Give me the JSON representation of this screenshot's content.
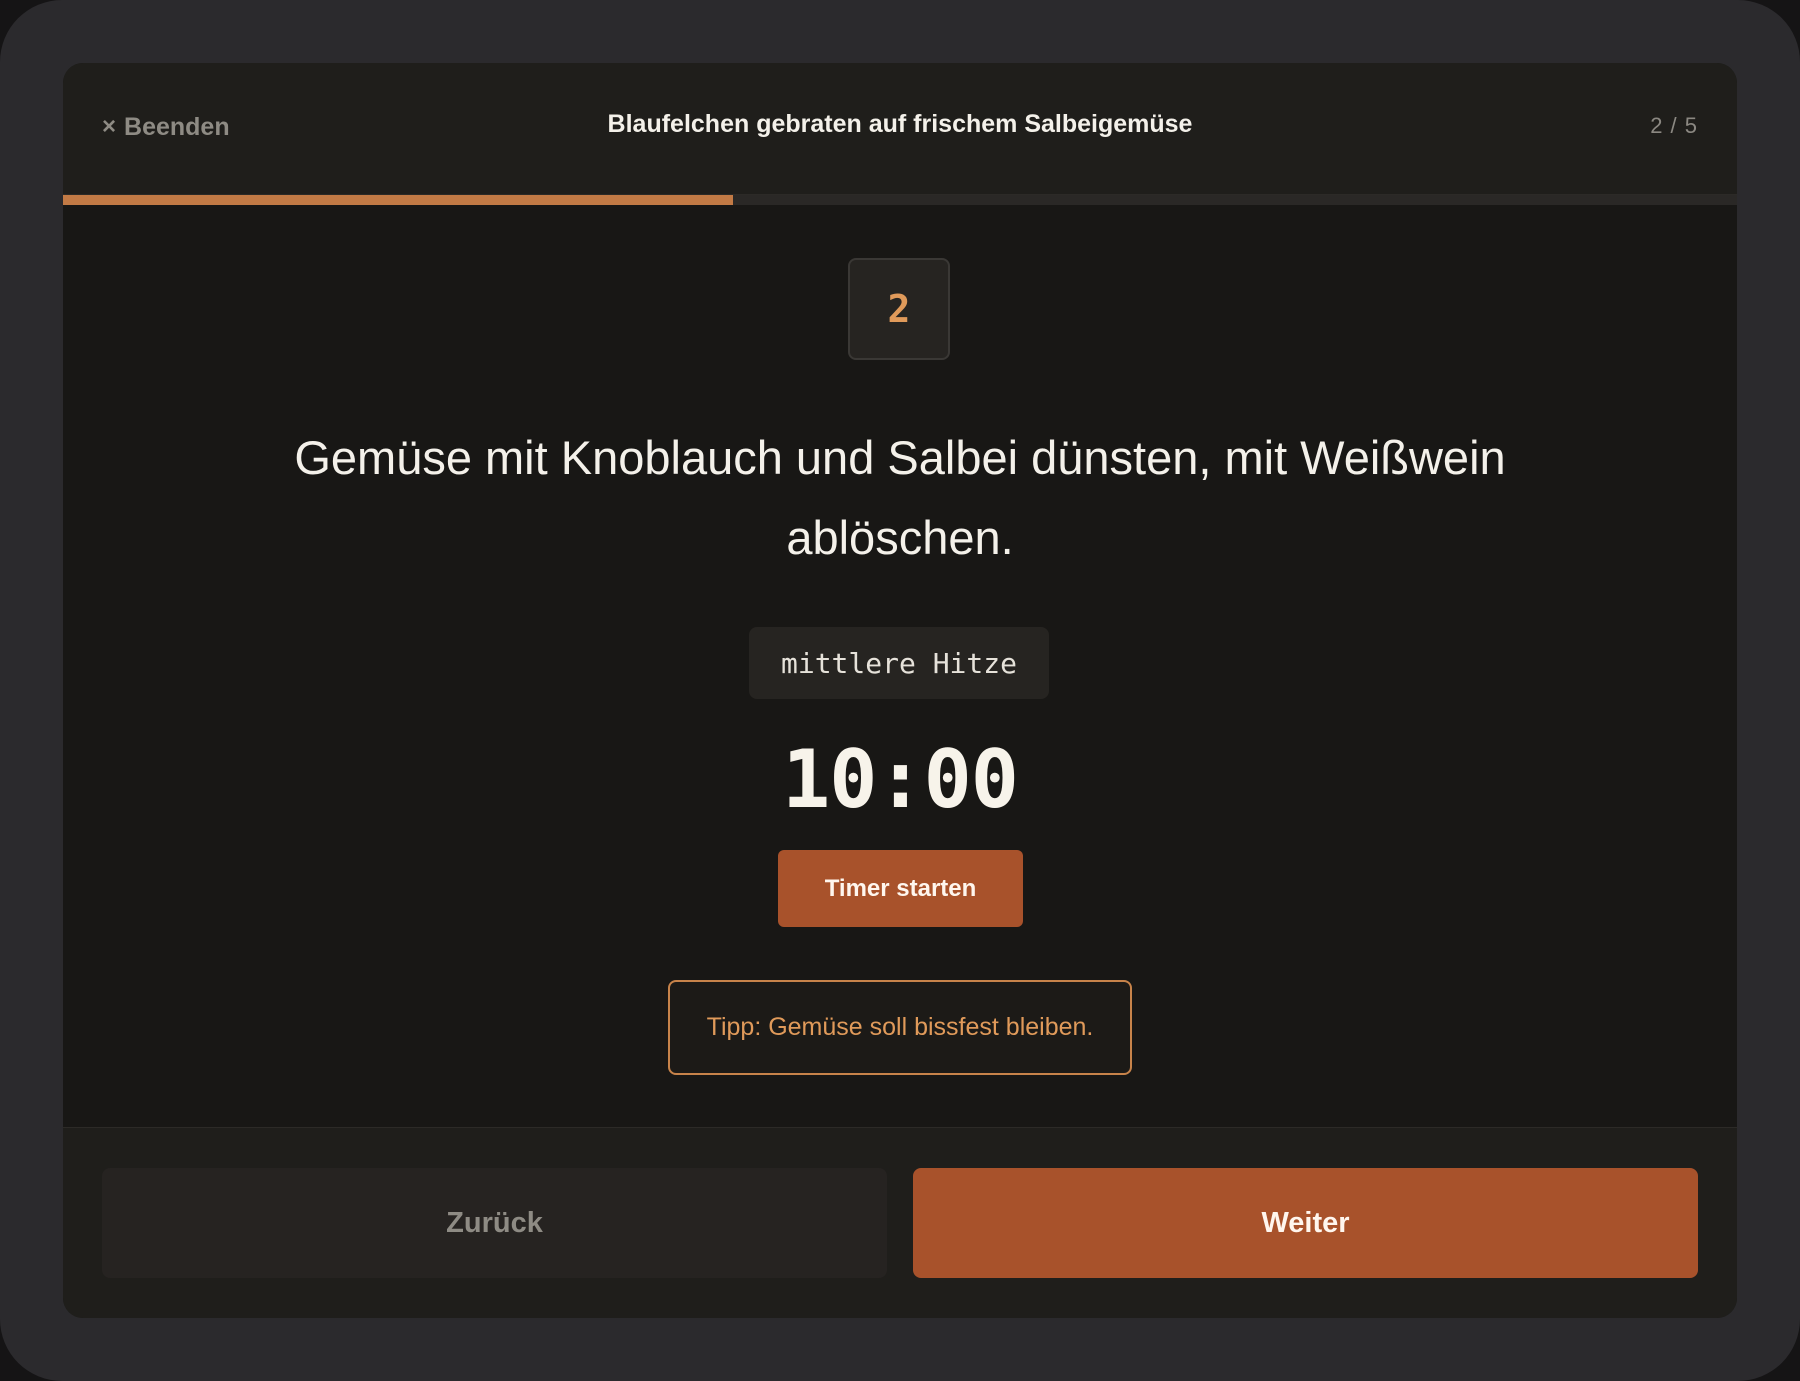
{
  "header": {
    "close_icon": "×",
    "close_label": "Beenden",
    "recipe_title": "Blaufelchen gebraten auf frischem Salbeigemüse",
    "step_counter": "2 / 5"
  },
  "progress": {
    "current_step": 2,
    "total_steps": 5,
    "fraction": 0.4,
    "fill_color": "#c27a45"
  },
  "step": {
    "number": "2",
    "instruction": "Gemüse mit Knoblauch und Salbei dünsten, mit Weißwein ablöschen.",
    "heat": "mittlere Hitze",
    "timer_value": "10:00",
    "timer_button_label": "Timer starten",
    "tip": "Tipp: Gemüse soll bissfest bleiben."
  },
  "footer": {
    "back_label": "Zurück",
    "next_label": "Weiter"
  },
  "colors": {
    "accent": "#a8522b",
    "accent_text": "#e09a5a",
    "background": "#181715"
  }
}
